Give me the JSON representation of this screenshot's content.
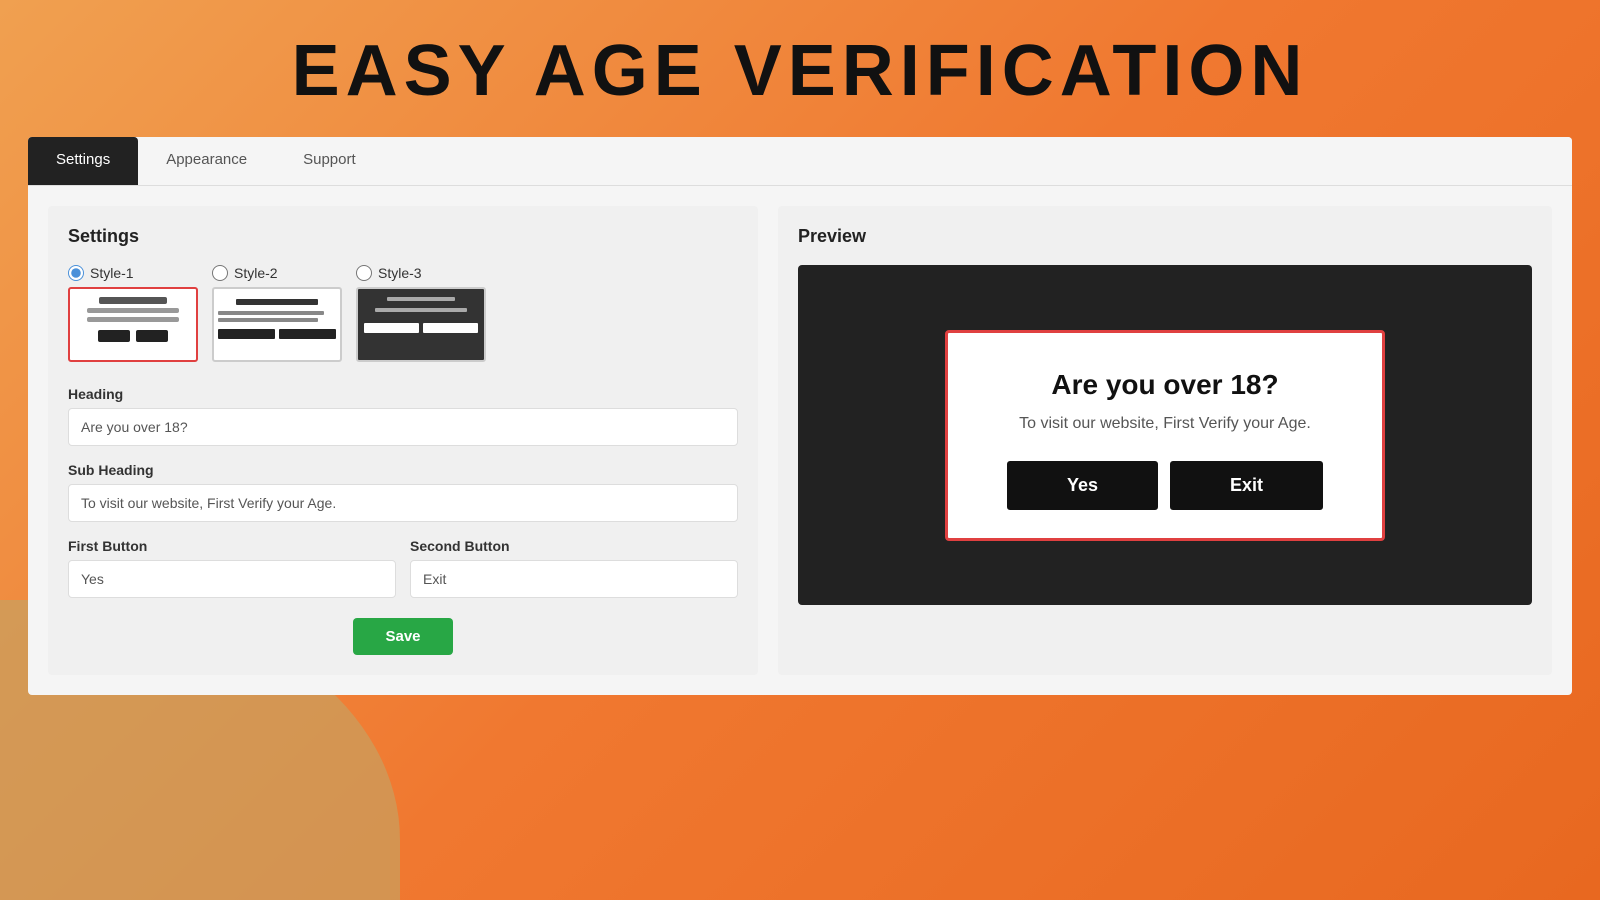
{
  "page": {
    "title": "EASY AGE VERIFICATION"
  },
  "tabs": [
    {
      "id": "settings",
      "label": "Settings",
      "active": true
    },
    {
      "id": "appearance",
      "label": "Appearance",
      "active": false
    },
    {
      "id": "support",
      "label": "Support",
      "active": false
    }
  ],
  "settings": {
    "panel_title": "Settings",
    "styles": [
      {
        "id": "style-1",
        "label": "Style-1",
        "selected": true
      },
      {
        "id": "style-2",
        "label": "Style-2",
        "selected": false
      },
      {
        "id": "style-3",
        "label": "Style-3",
        "selected": false
      }
    ],
    "heading_label": "Heading",
    "heading_value": "Are you over 18?",
    "subheading_label": "Sub Heading",
    "subheading_value": "To visit our website, First Verify your Age.",
    "first_button_label": "First Button",
    "first_button_value": "Yes",
    "second_button_label": "Second Button",
    "second_button_value": "Exit",
    "save_button_label": "Save"
  },
  "preview": {
    "title": "Preview",
    "modal_heading": "Are you over 18?",
    "modal_subheading": "To visit our website, First Verify your Age.",
    "yes_button": "Yes",
    "exit_button": "Exit"
  }
}
